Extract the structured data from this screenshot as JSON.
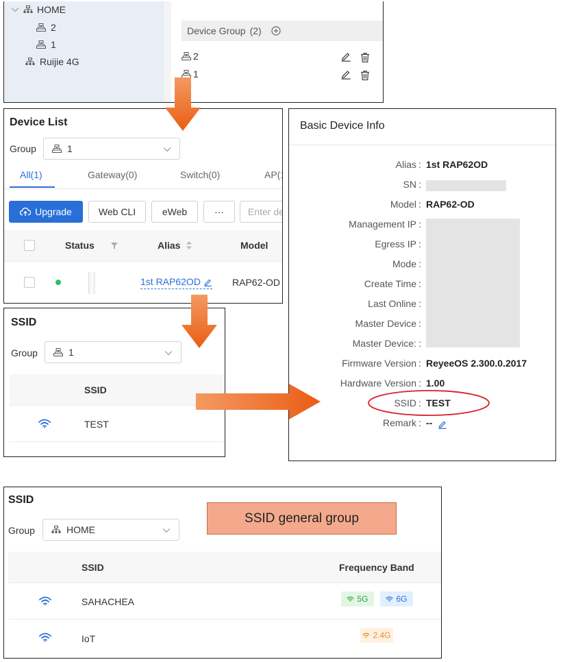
{
  "tree": {
    "root": "HOME",
    "children": [
      "2",
      "1"
    ],
    "other": "Ruijie 4G",
    "group_header_label": "Device Group",
    "group_header_count": "(2)",
    "groups": [
      "2",
      "1"
    ]
  },
  "device_list": {
    "title": "Device List",
    "group_label": "Group",
    "group_value": "1",
    "tabs": [
      "All(1)",
      "Gateway(0)",
      "Switch(0)",
      "AP(1"
    ],
    "buttons": {
      "upgrade": "Upgrade",
      "webcli": "Web CLI",
      "eweb": "eWeb",
      "more": "···"
    },
    "search_placeholder": "Enter de",
    "columns": {
      "status": "Status",
      "alias": "Alias",
      "model": "Model"
    },
    "row": {
      "alias": "1st RAP62OD",
      "model": "RAP62-OD"
    }
  },
  "ssid_panel": {
    "title": "SSID",
    "group_label": "Group",
    "group_value": "1",
    "column": "SSID",
    "row": "TEST"
  },
  "basic_info": {
    "title": "Basic Device Info",
    "fields": [
      {
        "label": "Alias",
        "value": "1st RAP62OD"
      },
      {
        "label": "SN",
        "value": ""
      },
      {
        "label": "Model",
        "value": "RAP62-OD"
      },
      {
        "label": "Management IP",
        "value": ""
      },
      {
        "label": "Egress IP",
        "value": ""
      },
      {
        "label": "Mode",
        "value": ""
      },
      {
        "label": "Create Time",
        "value": ""
      },
      {
        "label": "Last Online",
        "value": ""
      },
      {
        "label": "Master Device",
        "value": ""
      },
      {
        "label": "Master Device:",
        "value": ""
      },
      {
        "label": "Firmware Version",
        "value": "ReyeeOS 2.300.0.2017"
      },
      {
        "label": "Hardware Version",
        "value": "1.00"
      },
      {
        "label": "SSID",
        "value": "TEST"
      },
      {
        "label": "Remark",
        "value": "--"
      }
    ]
  },
  "ssid_general": {
    "title": "SSID",
    "group_label": "Group",
    "group_value": "HOME",
    "annotation": "SSID general group",
    "columns": {
      "ssid": "SSID",
      "band": "Frequency Band"
    },
    "rows": [
      {
        "name": "SAHACHEA",
        "bands": [
          "5G",
          "6G"
        ]
      },
      {
        "name": "IoT",
        "bands": [
          "2.4G"
        ]
      }
    ]
  },
  "colors": {
    "accent": "#2a6fd8",
    "arrow": "#ee6a21",
    "annotation_bg": "#f4a98c",
    "ellipse": "#d81f26",
    "online": "#2bbf6a",
    "tag_5g_bg": "#e3f6e5",
    "tag_5g_fg": "#2ba845",
    "tag_6g_bg": "#e2efff",
    "tag_6g_fg": "#2a6fd8",
    "tag_24_bg": "#fff1e2",
    "tag_24_fg": "#f08a24"
  }
}
